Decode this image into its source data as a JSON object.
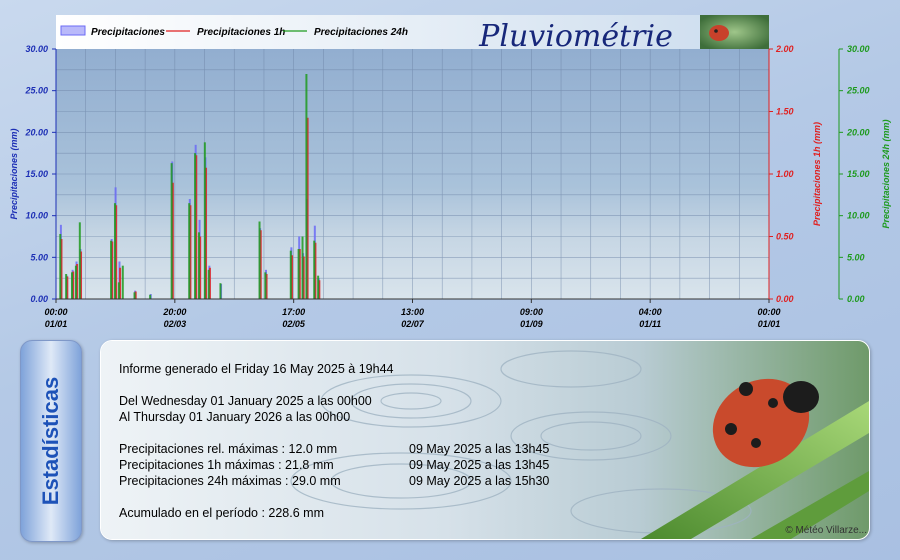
{
  "chart_data": {
    "type": "bar",
    "title": "Pluviométrie",
    "legend": [
      {
        "name": "Precipitaciones",
        "color": "#7c7cf0"
      },
      {
        "name": "Precipitaciones 1h",
        "color": "#e02020"
      },
      {
        "name": "Precipitaciones 24h",
        "color": "#1e9a1e"
      }
    ],
    "legend_position": "top-left",
    "grid": true,
    "axes": {
      "left": {
        "label": "Precipitaciones (mm)",
        "min": 0,
        "max": 30,
        "ticks": [
          "0.00",
          "5.00",
          "10.00",
          "15.00",
          "20.00",
          "25.00",
          "30.00"
        ],
        "color": "#1d2fb5"
      },
      "right1": {
        "label": "Precipitaciones 1h (mm)",
        "min": 0,
        "max": 2,
        "ticks": [
          "0.00",
          "0.50",
          "1.00",
          "1.50",
          "2.00"
        ],
        "color": "#e02020"
      },
      "right2": {
        "label": "Precipitaciones 24h (mm)",
        "min": 0,
        "max": 30,
        "ticks": [
          "0.00",
          "5.00",
          "10.00",
          "15.00",
          "20.00",
          "25.00",
          "30.00"
        ],
        "color": "#1e9a1e"
      }
    },
    "x_ticks": [
      {
        "time": "00:00",
        "date": "01/01"
      },
      {
        "time": "20:00",
        "date": "02/03"
      },
      {
        "time": "17:00",
        "date": "02/05"
      },
      {
        "time": "13:00",
        "date": "02/07"
      },
      {
        "time": "09:00",
        "date": "01/09"
      },
      {
        "time": "04:00",
        "date": "01/11"
      },
      {
        "time": "00:00",
        "date": "01/01"
      }
    ],
    "x_range": [
      "2025-01-01",
      "2026-01-01"
    ],
    "series": [
      {
        "name": "Precipitaciones",
        "axis": "left",
        "color": "#6b6bf5",
        "points": [
          [
            "2025-01-03",
            8.9
          ],
          [
            "2025-01-06",
            2.8
          ],
          [
            "2025-01-09",
            3.5
          ],
          [
            "2025-01-11",
            4.5
          ],
          [
            "2025-01-13",
            6.0
          ],
          [
            "2025-01-29",
            7.2
          ],
          [
            "2025-01-31",
            13.4
          ],
          [
            "2025-02-02",
            4.5
          ],
          [
            "2025-02-10",
            1.0
          ],
          [
            "2025-02-18",
            0.6
          ],
          [
            "2025-03-01",
            16.5
          ],
          [
            "2025-03-10",
            12.0
          ],
          [
            "2025-03-13",
            18.5
          ],
          [
            "2025-03-15",
            9.5
          ],
          [
            "2025-03-18",
            17.0
          ],
          [
            "2025-03-20",
            4.0
          ],
          [
            "2025-03-26",
            1.8
          ],
          [
            "2025-04-15",
            8.5
          ],
          [
            "2025-04-18",
            3.5
          ],
          [
            "2025-05-01",
            6.2
          ],
          [
            "2025-05-05",
            7.5
          ],
          [
            "2025-05-07",
            5.5
          ],
          [
            "2025-05-09",
            12.0
          ],
          [
            "2025-05-13",
            8.8
          ],
          [
            "2025-05-15",
            2.5
          ]
        ]
      },
      {
        "name": "Precipitaciones 1h",
        "axis": "right1",
        "color": "#e02020",
        "points": [
          [
            "2025-01-03",
            0.48
          ],
          [
            "2025-01-06",
            0.18
          ],
          [
            "2025-01-09",
            0.22
          ],
          [
            "2025-01-11",
            0.28
          ],
          [
            "2025-01-13",
            0.38
          ],
          [
            "2025-01-29",
            0.46
          ],
          [
            "2025-01-31",
            0.75
          ],
          [
            "2025-02-02",
            0.25
          ],
          [
            "2025-02-10",
            0.06
          ],
          [
            "2025-03-01",
            0.93
          ],
          [
            "2025-03-10",
            0.75
          ],
          [
            "2025-03-13",
            1.15
          ],
          [
            "2025-03-15",
            0.5
          ],
          [
            "2025-03-18",
            1.05
          ],
          [
            "2025-03-20",
            0.25
          ],
          [
            "2025-04-15",
            0.55
          ],
          [
            "2025-04-18",
            0.2
          ],
          [
            "2025-05-01",
            0.35
          ],
          [
            "2025-05-05",
            0.4
          ],
          [
            "2025-05-07",
            0.34
          ],
          [
            "2025-05-09",
            1.45
          ],
          [
            "2025-05-13",
            0.45
          ],
          [
            "2025-05-15",
            0.15
          ]
        ]
      },
      {
        "name": "Precipitaciones 24h",
        "axis": "right2",
        "color": "#1e9a1e",
        "points": [
          [
            "2025-01-03",
            7.8
          ],
          [
            "2025-01-06",
            3.0
          ],
          [
            "2025-01-09",
            3.2
          ],
          [
            "2025-01-11",
            4.0
          ],
          [
            "2025-01-13",
            9.2
          ],
          [
            "2025-01-29",
            7.0
          ],
          [
            "2025-01-31",
            11.5
          ],
          [
            "2025-02-02",
            2.0
          ],
          [
            "2025-02-04",
            4.0
          ],
          [
            "2025-02-10",
            0.8
          ],
          [
            "2025-02-18",
            0.5
          ],
          [
            "2025-03-01",
            16.3
          ],
          [
            "2025-03-10",
            11.5
          ],
          [
            "2025-03-13",
            17.5
          ],
          [
            "2025-03-15",
            8.0
          ],
          [
            "2025-03-18",
            18.8
          ],
          [
            "2025-03-20",
            3.5
          ],
          [
            "2025-03-26",
            1.9
          ],
          [
            "2025-04-15",
            9.3
          ],
          [
            "2025-04-18",
            3.2
          ],
          [
            "2025-05-01",
            5.8
          ],
          [
            "2025-05-05",
            6.0
          ],
          [
            "2025-05-07",
            7.5
          ],
          [
            "2025-05-09",
            27.0
          ],
          [
            "2025-05-13",
            7.0
          ],
          [
            "2025-05-15",
            2.8
          ]
        ]
      }
    ]
  },
  "stats": {
    "side_label": "Estadísticas",
    "generated": "Informe generado el Friday 16 May 2025 à 19h44",
    "from": "Del Wednesday 01 January 2025 a las 00h00",
    "to": "Al Thursday 01 January 2026 a las 00h00",
    "max_rel_label": "Precipitaciones rel. máximas : 12.0 mm",
    "max_rel_date": "09 May 2025 a las 13h45",
    "max_1h_label": "Precipitaciones 1h máximas : 21.8 mm",
    "max_1h_date": "09 May 2025 a las 13h45",
    "max_24h_label": "Precipitaciones 24h máximas : 29.0 mm",
    "max_24h_date": "09 May 2025 a las 15h30",
    "total": "Acumulado en el período : 228.6 mm",
    "copyright": "© Météo Villarze..."
  }
}
